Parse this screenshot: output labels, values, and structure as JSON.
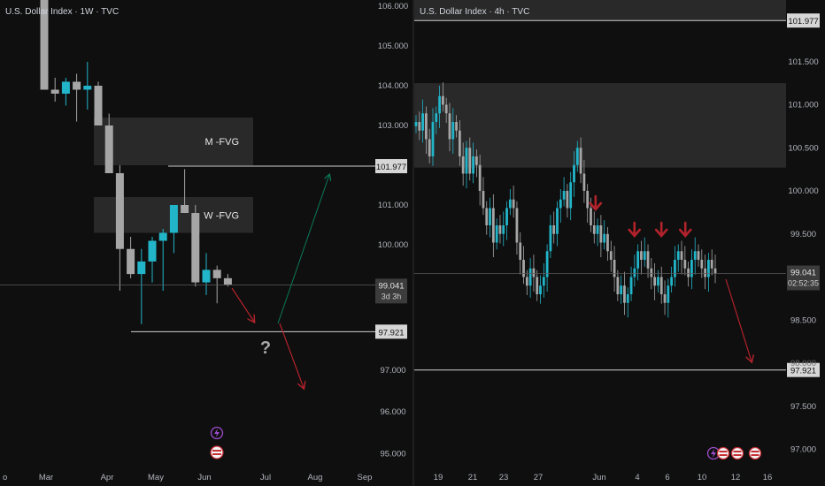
{
  "panels": {
    "left": {
      "title": "U.S. Dollar Index · 1W · TVC",
      "price_axis": [
        "106.000",
        "105.000",
        "104.000",
        "103.000",
        "101.000",
        "100.000",
        "97.000",
        "96.000",
        "95.000"
      ],
      "time_axis": [
        "Mar",
        "Apr",
        "May",
        "Jun",
        "Jul",
        "Aug",
        "Sep"
      ],
      "time_axis_partial_left": "o",
      "zones": [
        {
          "label": "M -FVG"
        },
        {
          "label": "W -FVG"
        }
      ],
      "levels": [
        {
          "price_label": "101.977"
        },
        {
          "price_label": "97.921"
        }
      ],
      "current_price": {
        "value": "99.041",
        "countdown": "3d 3h"
      },
      "question_mark": "?"
    },
    "right": {
      "title": "U.S. Dollar Index · 4h · TVC",
      "price_axis": [
        "101.500",
        "101.000",
        "100.500",
        "100.000",
        "99.500",
        "98.500",
        "97.500",
        "97.000"
      ],
      "price_axis_partial": "98.000",
      "time_axis": [
        "19",
        "21",
        "23",
        "27",
        "Jun",
        "4",
        "6",
        "10",
        "12",
        "16"
      ],
      "levels": [
        {
          "price_label": "101.977"
        },
        {
          "price_label": "97.921"
        }
      ],
      "current_price": {
        "value": "99.041",
        "countdown": "02:52:35"
      }
    }
  },
  "colors": {
    "background": "#0f0f0f",
    "bull_candle": "#22b5c9",
    "bear_candle": "#a6a6a6",
    "zone_fill": "#2e2e2e",
    "level_line": "#cfcfcf",
    "arrow_red": "#b2222b",
    "arrow_green": "#0c7a5a",
    "event_purple": "#9c4dcc",
    "event_flag": "#c62f36"
  },
  "icons": [
    "lightning-icon",
    "us-flag-icon"
  ],
  "chart_data": [
    {
      "type": "candlestick",
      "title": "U.S. Dollar Index · 1W · TVC",
      "timeframe": "1W",
      "y_axis": {
        "ylim": [
          94.5,
          106.2
        ],
        "ticks": [
          106,
          105,
          104,
          103,
          101,
          100,
          97,
          96,
          95
        ]
      },
      "candles": [
        {
          "o": 106.5,
          "h": 106.9,
          "l": 103.9,
          "c": 103.9
        },
        {
          "o": 103.9,
          "h": 104.2,
          "l": 103.6,
          "c": 103.8
        },
        {
          "o": 103.8,
          "h": 104.2,
          "l": 103.5,
          "c": 104.1
        },
        {
          "o": 104.1,
          "h": 104.3,
          "l": 103.1,
          "c": 103.9
        },
        {
          "o": 103.9,
          "h": 104.6,
          "l": 103.4,
          "c": 104.0
        },
        {
          "o": 104.0,
          "h": 104.1,
          "l": 103.0,
          "c": 103.0
        },
        {
          "o": 103.0,
          "h": 103.3,
          "l": 101.8,
          "c": 101.8
        },
        {
          "o": 101.8,
          "h": 102.0,
          "l": 98.9,
          "c": 99.9
        },
        {
          "o": 99.9,
          "h": 100.2,
          "l": 99.2,
          "c": 99.3
        },
        {
          "o": 99.3,
          "h": 99.9,
          "l": 98.1,
          "c": 99.6
        },
        {
          "o": 99.6,
          "h": 100.2,
          "l": 99.1,
          "c": 100.1
        },
        {
          "o": 100.1,
          "h": 100.4,
          "l": 98.9,
          "c": 100.3
        },
        {
          "o": 100.3,
          "h": 101.0,
          "l": 99.8,
          "c": 101.0
        },
        {
          "o": 101.0,
          "h": 101.9,
          "l": 100.8,
          "c": 100.8
        },
        {
          "o": 100.8,
          "h": 101.0,
          "l": 99.0,
          "c": 99.1
        },
        {
          "o": 99.1,
          "h": 99.8,
          "l": 98.8,
          "c": 99.4
        },
        {
          "o": 99.4,
          "h": 99.5,
          "l": 98.6,
          "c": 99.2
        },
        {
          "o": 99.2,
          "h": 99.3,
          "l": 99.0,
          "c": 99.04
        }
      ],
      "zones": [
        {
          "label": "M -FVG",
          "from": 102.0,
          "to": 103.2
        },
        {
          "label": "W -FVG",
          "from": 100.3,
          "to": 101.2
        }
      ],
      "horizontal_levels": [
        101.977,
        97.921
      ],
      "current_price": 99.041,
      "projections": [
        {
          "path": [
            [
              99.0,
              "now"
            ],
            [
              98.1,
              "+3w"
            ]
          ],
          "direction": "down"
        },
        {
          "path": [
            [
              98.1,
              "+3w"
            ],
            [
              101.9,
              "+8w"
            ]
          ],
          "direction": "up"
        },
        {
          "path": [
            [
              97.9,
              "+4w"
            ],
            [
              96.6,
              "+8w"
            ]
          ],
          "direction": "down"
        }
      ]
    },
    {
      "type": "candlestick",
      "title": "U.S. Dollar Index · 4h · TVC",
      "timeframe": "4h",
      "y_axis": {
        "ylim": [
          96.8,
          102.05
        ],
        "ticks": [
          101.5,
          101.0,
          100.5,
          100.0,
          99.5,
          98.5,
          97.5,
          97.0
        ]
      },
      "closes": [
        100.8,
        100.7,
        100.9,
        100.6,
        100.4,
        100.8,
        100.9,
        101.1,
        101.0,
        100.9,
        100.6,
        100.8,
        100.7,
        100.4,
        100.2,
        100.5,
        100.2,
        100.4,
        100.3,
        100.0,
        99.8,
        99.6,
        99.8,
        99.4,
        99.6,
        99.5,
        99.6,
        99.8,
        99.9,
        99.8,
        99.4,
        99.2,
        99.0,
        98.9,
        99.1,
        99.0,
        98.8,
        98.9,
        99.0,
        99.3,
        99.6,
        99.5,
        99.8,
        99.9,
        100.0,
        99.8,
        100.1,
        100.3,
        100.5,
        100.2,
        100.0,
        99.8,
        99.6,
        99.5,
        99.6,
        99.4,
        99.5,
        99.3,
        99.2,
        99.0,
        98.8,
        98.9,
        98.7,
        98.8,
        99.0,
        99.1,
        99.3,
        99.2,
        99.3,
        99.1,
        99.0,
        98.9,
        99.0,
        98.8,
        98.7,
        98.9,
        99.0,
        99.2,
        99.3,
        99.2,
        99.1,
        99.0,
        99.2,
        99.3,
        99.2,
        99.1,
        99.0,
        99.2,
        99.1,
        99.04
      ],
      "zones": [
        {
          "from": 100.27,
          "to": 101.25
        }
      ],
      "horizontal_levels": [
        101.977,
        97.921
      ],
      "current_price": 99.041,
      "markers": [
        {
          "type": "down-arrow",
          "x_fraction": 0.6
        },
        {
          "type": "down-arrow",
          "x_fraction": 0.73
        },
        {
          "type": "down-arrow",
          "x_fraction": 0.82
        },
        {
          "type": "down-arrow",
          "x_fraction": 0.9
        }
      ],
      "projection": {
        "from": 99.0,
        "to": 97.95,
        "direction": "down"
      }
    }
  ]
}
